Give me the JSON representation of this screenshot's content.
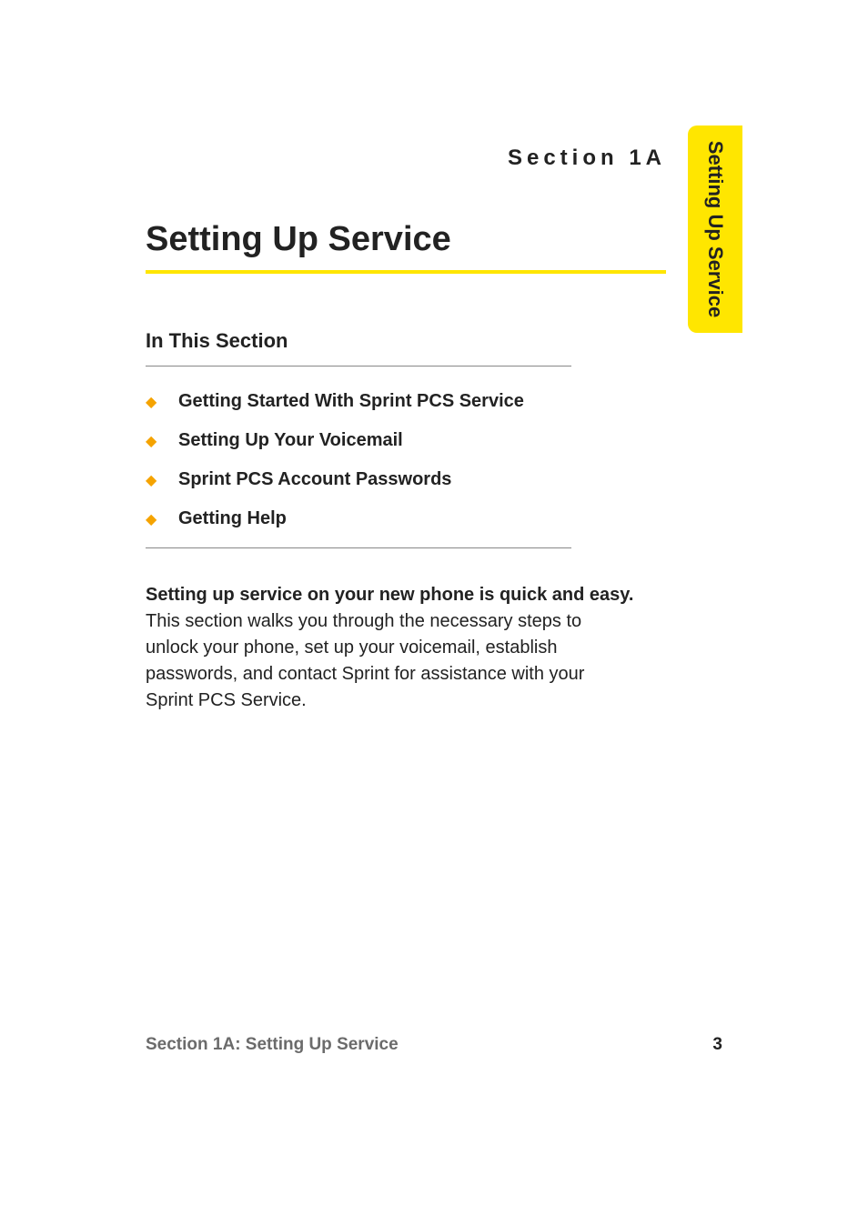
{
  "header": {
    "section_label": "Section 1A"
  },
  "side_tab": {
    "label": "Setting Up Service"
  },
  "title": "Setting Up Service",
  "subheading": "In This Section",
  "toc": [
    "Getting Started With Sprint PCS Service",
    "Setting Up Your Voicemail",
    "Sprint PCS Account Passwords",
    "Getting Help"
  ],
  "body": {
    "lead": "Setting up service on your new phone is quick and easy.",
    "rest": " This section walks you through the necessary steps to unlock your phone, set up your voicemail, establish passwords, and contact Sprint for assistance with your Sprint PCS Service."
  },
  "footer": {
    "left": "Section 1A: Setting Up Service",
    "page_number": "3"
  },
  "colors": {
    "accent_yellow": "#ffe600",
    "bullet_orange": "#f5a300"
  }
}
